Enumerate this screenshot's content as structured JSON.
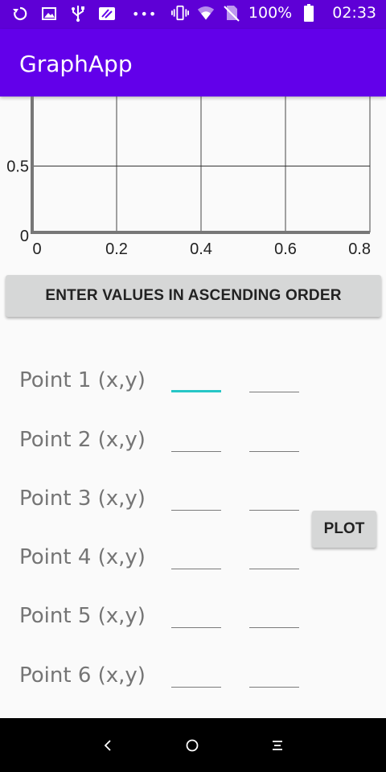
{
  "status_bar": {
    "left_icons": [
      "sync-icon",
      "image-icon",
      "usb-icon",
      "card-icon",
      "more-dots-icon"
    ],
    "right_icons": [
      "vibrate-icon",
      "wifi-icon",
      "no-sim-icon",
      "battery-icon"
    ],
    "battery": "100%",
    "time": "02:33",
    "dots": "•••"
  },
  "app_bar": {
    "title": "GraphApp"
  },
  "chart_data": {
    "type": "line",
    "x_ticks": [
      "0",
      "0.2",
      "0.4",
      "0.6",
      "0.8"
    ],
    "y_ticks": [
      "0",
      "0.5"
    ],
    "xlim": [
      0,
      0.8
    ],
    "ylim": [
      0,
      0.8
    ],
    "grid": true,
    "series": []
  },
  "info_button": {
    "label": "ENTER VALUES IN ASCENDING ORDER"
  },
  "points": [
    {
      "label": "Point 1 (x,y)",
      "x": "",
      "y": ""
    },
    {
      "label": "Point 2 (x,y)",
      "x": "",
      "y": ""
    },
    {
      "label": "Point 3 (x,y)",
      "x": "",
      "y": ""
    },
    {
      "label": "Point 4 (x,y)",
      "x": "",
      "y": ""
    },
    {
      "label": "Point 5 (x,y)",
      "x": "",
      "y": ""
    },
    {
      "label": "Point 6 (x,y)",
      "x": "",
      "y": ""
    }
  ],
  "plot_button": {
    "label": "PLOT"
  },
  "nav_bar": {
    "icons": [
      "back-icon",
      "home-icon",
      "recents-icon"
    ]
  },
  "colors": {
    "status_bar": "#5e00d6",
    "app_bar": "#6200ea",
    "focus_accent": "#26c6c6",
    "button": "#d6d7d7"
  }
}
